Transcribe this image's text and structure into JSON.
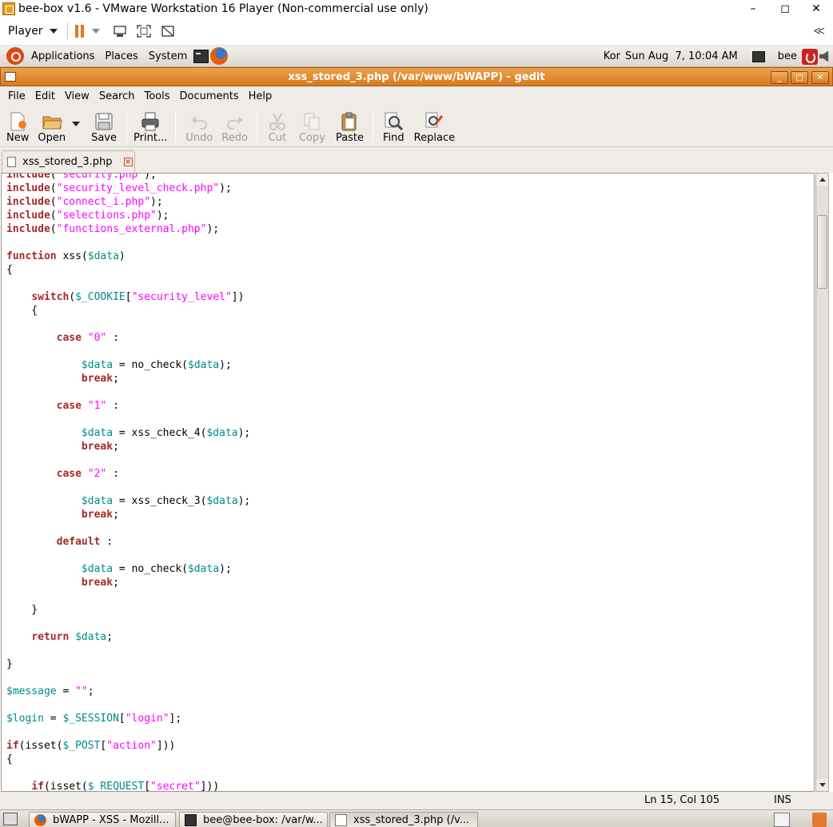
{
  "vm_window": {
    "title": "bee-box v1.6 - VMware Workstation 16 Player (Non-commercial use only)",
    "minimize_glyph": "–",
    "maximize_glyph": "◻",
    "close_glyph": "✕"
  },
  "vm_toolbar": {
    "player_menu": "Player",
    "collapse_glyph": "≪"
  },
  "gnome_panel": {
    "menus": [
      "Applications",
      "Places",
      "System"
    ],
    "keyboard_layout": "Kor",
    "clock": "Sun Aug  7, 10:04 AM",
    "user": "bee"
  },
  "gedit": {
    "window_title": "xss_stored_3.php (/var/www/bWAPP) - gedit",
    "menubar": [
      "File",
      "Edit",
      "View",
      "Search",
      "Tools",
      "Documents",
      "Help"
    ],
    "toolbar": {
      "new": "New",
      "open": "Open",
      "save": "Save",
      "print": "Print...",
      "undo": "Undo",
      "redo": "Redo",
      "cut": "Cut",
      "copy": "Copy",
      "paste": "Paste",
      "find": "Find",
      "replace": "Replace"
    },
    "tab": {
      "label": "xss_stored_3.php"
    },
    "status": {
      "position": "Ln 15, Col 105",
      "mode": "INS"
    }
  },
  "syntax_colors": {
    "keyword": "#a52a2a",
    "string": "#ff00ff",
    "variable": "#008a8c",
    "plain": "#000000"
  },
  "code_lines": [
    [
      [
        "k",
        "include"
      ],
      [
        "p",
        "("
      ],
      [
        "s",
        "\"security.php\""
      ],
      [
        "p",
        ");"
      ]
    ],
    [
      [
        "k",
        "include"
      ],
      [
        "p",
        "("
      ],
      [
        "s",
        "\"security_level_check.php\""
      ],
      [
        "p",
        ");"
      ]
    ],
    [
      [
        "k",
        "include"
      ],
      [
        "p",
        "("
      ],
      [
        "s",
        "\"connect_i.php\""
      ],
      [
        "p",
        ");"
      ]
    ],
    [
      [
        "k",
        "include"
      ],
      [
        "p",
        "("
      ],
      [
        "s",
        "\"selections.php\""
      ],
      [
        "p",
        ");"
      ]
    ],
    [
      [
        "k",
        "include"
      ],
      [
        "p",
        "("
      ],
      [
        "s",
        "\"functions_external.php\""
      ],
      [
        "p",
        ");"
      ]
    ],
    [],
    [
      [
        "k",
        "function"
      ],
      [
        "p",
        " xss("
      ],
      [
        "v",
        "$data"
      ],
      [
        "p",
        ")"
      ]
    ],
    [
      [
        "p",
        "{"
      ]
    ],
    [],
    [
      [
        "p",
        "    "
      ],
      [
        "k",
        "switch"
      ],
      [
        "p",
        "("
      ],
      [
        "v",
        "$_COOKIE"
      ],
      [
        "p",
        "["
      ],
      [
        "s",
        "\"security_level\""
      ],
      [
        "p",
        "])"
      ]
    ],
    [
      [
        "p",
        "    {"
      ]
    ],
    [],
    [
      [
        "p",
        "        "
      ],
      [
        "k",
        "case"
      ],
      [
        "p",
        " "
      ],
      [
        "s",
        "\"0\""
      ],
      [
        "p",
        " :"
      ]
    ],
    [],
    [
      [
        "p",
        "            "
      ],
      [
        "v",
        "$data"
      ],
      [
        "p",
        " = no_check("
      ],
      [
        "v",
        "$data"
      ],
      [
        "p",
        ");"
      ]
    ],
    [
      [
        "p",
        "            "
      ],
      [
        "k",
        "break"
      ],
      [
        "p",
        ";"
      ]
    ],
    [],
    [
      [
        "p",
        "        "
      ],
      [
        "k",
        "case"
      ],
      [
        "p",
        " "
      ],
      [
        "s",
        "\"1\""
      ],
      [
        "p",
        " :"
      ]
    ],
    [],
    [
      [
        "p",
        "            "
      ],
      [
        "v",
        "$data"
      ],
      [
        "p",
        " = xss_check_4("
      ],
      [
        "v",
        "$data"
      ],
      [
        "p",
        ");"
      ]
    ],
    [
      [
        "p",
        "            "
      ],
      [
        "k",
        "break"
      ],
      [
        "p",
        ";"
      ]
    ],
    [],
    [
      [
        "p",
        "        "
      ],
      [
        "k",
        "case"
      ],
      [
        "p",
        " "
      ],
      [
        "s",
        "\"2\""
      ],
      [
        "p",
        " :"
      ]
    ],
    [],
    [
      [
        "p",
        "            "
      ],
      [
        "v",
        "$data"
      ],
      [
        "p",
        " = xss_check_3("
      ],
      [
        "v",
        "$data"
      ],
      [
        "p",
        ");"
      ]
    ],
    [
      [
        "p",
        "            "
      ],
      [
        "k",
        "break"
      ],
      [
        "p",
        ";"
      ]
    ],
    [],
    [
      [
        "p",
        "        "
      ],
      [
        "k",
        "default"
      ],
      [
        "p",
        " :"
      ]
    ],
    [],
    [
      [
        "p",
        "            "
      ],
      [
        "v",
        "$data"
      ],
      [
        "p",
        " = no_check("
      ],
      [
        "v",
        "$data"
      ],
      [
        "p",
        ");"
      ]
    ],
    [
      [
        "p",
        "            "
      ],
      [
        "k",
        "break"
      ],
      [
        "p",
        ";"
      ]
    ],
    [],
    [
      [
        "p",
        "    }"
      ]
    ],
    [],
    [
      [
        "p",
        "    "
      ],
      [
        "k",
        "return"
      ],
      [
        "p",
        " "
      ],
      [
        "v",
        "$data"
      ],
      [
        "p",
        ";"
      ]
    ],
    [],
    [
      [
        "p",
        "}"
      ]
    ],
    [],
    [
      [
        "v",
        "$message"
      ],
      [
        "p",
        " = "
      ],
      [
        "s",
        "\"\""
      ],
      [
        "p",
        ";"
      ]
    ],
    [],
    [
      [
        "v",
        "$login"
      ],
      [
        "p",
        " = "
      ],
      [
        "v",
        "$_SESSION"
      ],
      [
        "p",
        "["
      ],
      [
        "s",
        "\"login\""
      ],
      [
        "p",
        "];"
      ]
    ],
    [],
    [
      [
        "k",
        "if"
      ],
      [
        "p",
        "(isset("
      ],
      [
        "v",
        "$_POST"
      ],
      [
        "p",
        "["
      ],
      [
        "s",
        "\"action\""
      ],
      [
        "p",
        "]))"
      ]
    ],
    [
      [
        "p",
        "{"
      ]
    ],
    [],
    [
      [
        "p",
        "    "
      ],
      [
        "k",
        "if"
      ],
      [
        "p",
        "(isset("
      ],
      [
        "v",
        "$_REQUEST"
      ],
      [
        "p",
        "["
      ],
      [
        "s",
        "\"secret\""
      ],
      [
        "p",
        "]))"
      ]
    ]
  ],
  "taskbar": {
    "items": [
      {
        "label": "bWAPP - XSS - Mozill...",
        "icon": "firefox-icon"
      },
      {
        "label": "bee@bee-box: /var/w...",
        "icon": "terminal-icon"
      },
      {
        "label": "xss_stored_3.php (/v...",
        "icon": "text-editor-icon"
      }
    ]
  }
}
